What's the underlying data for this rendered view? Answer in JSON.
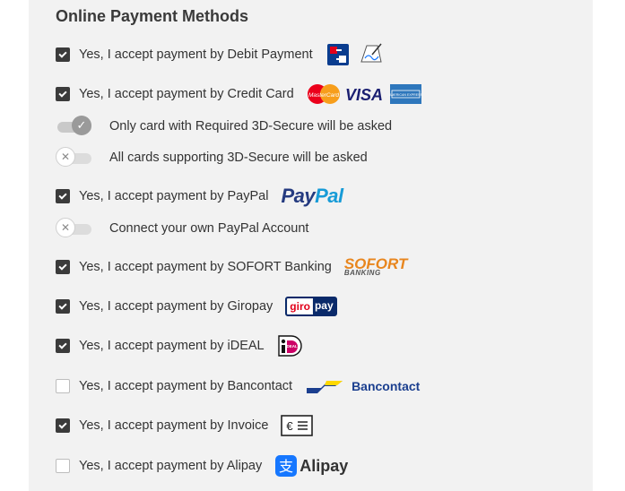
{
  "section_title": "Online Payment Methods",
  "methods": [
    {
      "label": "Yes, I accept payment by Debit Payment",
      "checked": true,
      "icon": "ec-card-icon"
    },
    {
      "label": "Yes, I accept payment by Credit Card",
      "checked": true,
      "icon": "credit-cards-icon"
    },
    {
      "label": "Yes, I accept payment by PayPal",
      "checked": true,
      "icon": "paypal-icon"
    },
    {
      "label": "Yes, I accept payment by SOFORT Banking",
      "checked": true,
      "icon": "sofort-icon"
    },
    {
      "label": "Yes, I accept payment by Giropay",
      "checked": true,
      "icon": "giropay-icon"
    },
    {
      "label": "Yes, I accept payment by iDEAL",
      "checked": true,
      "icon": "ideal-icon"
    },
    {
      "label": "Yes, I accept payment by Bancontact",
      "checked": false,
      "icon": "bancontact-icon"
    },
    {
      "label": "Yes, I accept payment by Invoice",
      "checked": true,
      "icon": "invoice-icon"
    },
    {
      "label": "Yes, I accept payment by Alipay",
      "checked": false,
      "icon": "alipay-icon"
    }
  ],
  "toggles": [
    {
      "label": "Only card with Required 3D-Secure will be asked",
      "on": true
    },
    {
      "label": "All cards supporting 3D-Secure will be asked",
      "on": false
    },
    {
      "label": "Connect your own PayPal Account",
      "on": false
    }
  ],
  "logos": {
    "mastercard": "MasterCard",
    "visa": "VISA",
    "amex": "AMERICAN EXPRESS",
    "paypal_a": "Pay",
    "paypal_b": "Pal",
    "sofort": "SOFORT",
    "sofort_sub": "BANKING",
    "giro_a": "giro",
    "giro_b": "pay",
    "ideal": "iDEAL",
    "bancontact": "Bancontact",
    "invoice": "€",
    "alipay": "Alipay",
    "alipay_char": "支"
  },
  "colors": {
    "panel": "#f2f2f2",
    "checkbox_on": "#3b3b3b",
    "paypal_dark": "#253b80",
    "paypal_light": "#179bd7",
    "sofort": "#e8861e",
    "giro_red": "#e2001a",
    "giro_blue": "#0a2a6a",
    "bancontact": "#1b3f8f",
    "alipay": "#1677ff"
  }
}
